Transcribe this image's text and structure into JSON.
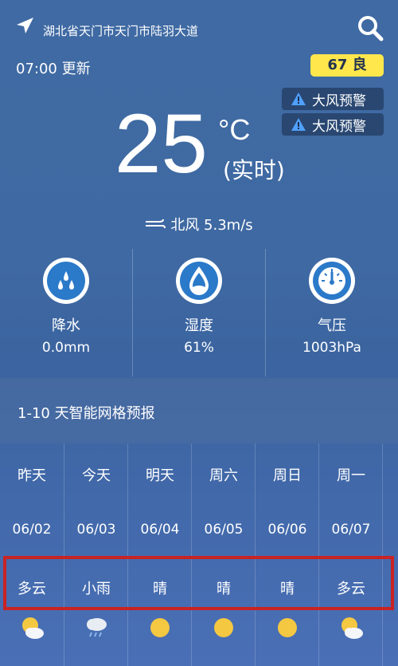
{
  "header": {
    "location": "湖北省天门市天门市陆羽大道",
    "update_time": "07:00 更新",
    "aqi": "67 良"
  },
  "warnings": [
    "大风预警",
    "大风预警"
  ],
  "current": {
    "temperature": "25",
    "unit": "°C",
    "realtime_label": "(实时)",
    "wind": "北风 5.3m/s"
  },
  "metrics": [
    {
      "label": "降水",
      "value": "0.0mm",
      "icon": "rain-drops-icon"
    },
    {
      "label": "湿度",
      "value": "61%",
      "icon": "water-drop-icon"
    },
    {
      "label": "气压",
      "value": "1003hPa",
      "icon": "gauge-icon"
    }
  ],
  "forecast": {
    "title": "1-10 天智能网格预报",
    "days": [
      {
        "name": "昨天",
        "date": "06/02",
        "cond": "多云",
        "icon": "partly-cloudy-icon"
      },
      {
        "name": "今天",
        "date": "06/03",
        "cond": "小雨",
        "icon": "light-rain-icon"
      },
      {
        "name": "明天",
        "date": "06/04",
        "cond": "晴",
        "icon": "sunny-icon"
      },
      {
        "name": "周六",
        "date": "06/05",
        "cond": "晴",
        "icon": "sunny-icon"
      },
      {
        "name": "周日",
        "date": "06/06",
        "cond": "晴",
        "icon": "sunny-icon"
      },
      {
        "name": "周一",
        "date": "06/07",
        "cond": "多云",
        "icon": "partly-cloudy-icon"
      }
    ]
  },
  "colors": {
    "aqi_badge": "#ffe74c",
    "highlight_border": "#c92324"
  }
}
